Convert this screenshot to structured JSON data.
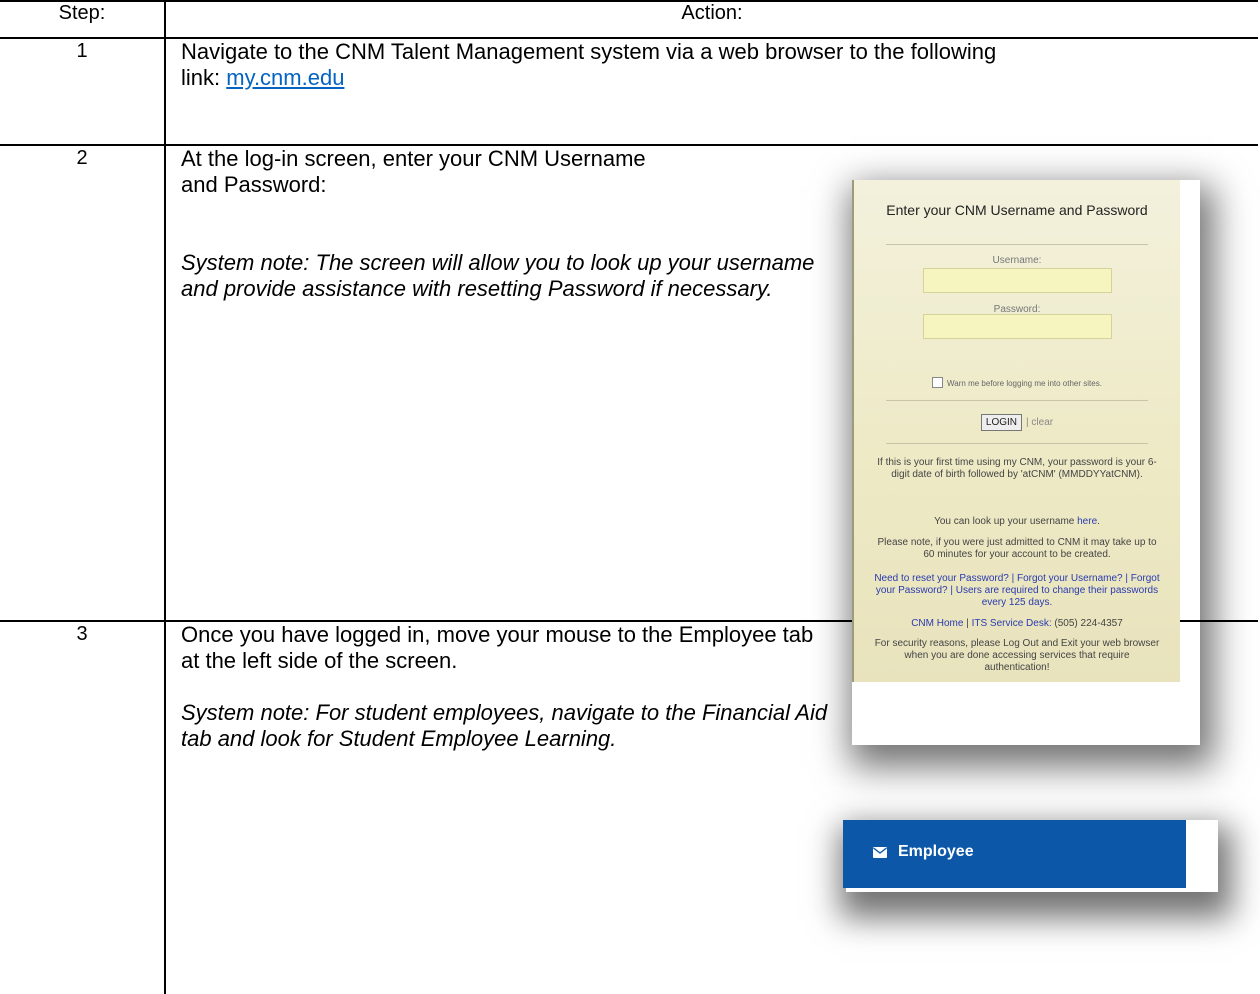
{
  "header": {
    "step": "Step:",
    "action": "Action:"
  },
  "rows": [
    {
      "step": "1",
      "text_before_link": "Navigate to the CNM Talent Management system via a web browser to the following link: ",
      "link": "my.cnm.edu"
    },
    {
      "step": "2",
      "text": "At the log-in screen, enter your CNM Username and Password:",
      "note": "System note: The screen will allow you to look up your username and provide assistance with resetting Password if necessary."
    },
    {
      "step": "3",
      "text": "Once you have logged in, move your mouse to the Employee tab at the left side of the screen.",
      "note": "System note: For student employees, navigate to the Financial Aid tab and look for Student Employee Learning."
    }
  ],
  "login_panel": {
    "title": "Enter your CNM Username and Password",
    "username_label": "Username:",
    "password_label": "Password:",
    "warn_label": "Warn me before logging me into other sites.",
    "login_button": "LOGIN",
    "clear_link": "clear",
    "first_time_text": "If this is your first time using my CNM, your password is your 6-digit date of birth followed by 'atCNM' (MMDDYYatCNM).",
    "lookup_text": "You can look up your username ",
    "lookup_link": "here",
    "admitted_text": "Please note, if you were just admitted to CNM it may take up to 60 minutes for your account to be created.",
    "reset_links": "Need to reset your Password? | Forgot your Username? | Forgot your Password? | Users are required to change their passwords every 125 days.",
    "cnm_home": "CNM Home",
    "service_desk": "ITS Service Desk:",
    "phone": "(505) 224-4357",
    "security_text": "For security reasons, please Log Out and Exit your web browser when you are done accessing services that require authentication!"
  },
  "employee_button": {
    "label": "Employee",
    "icon": "mail-icon",
    "bg_color": "#0d57a8"
  }
}
